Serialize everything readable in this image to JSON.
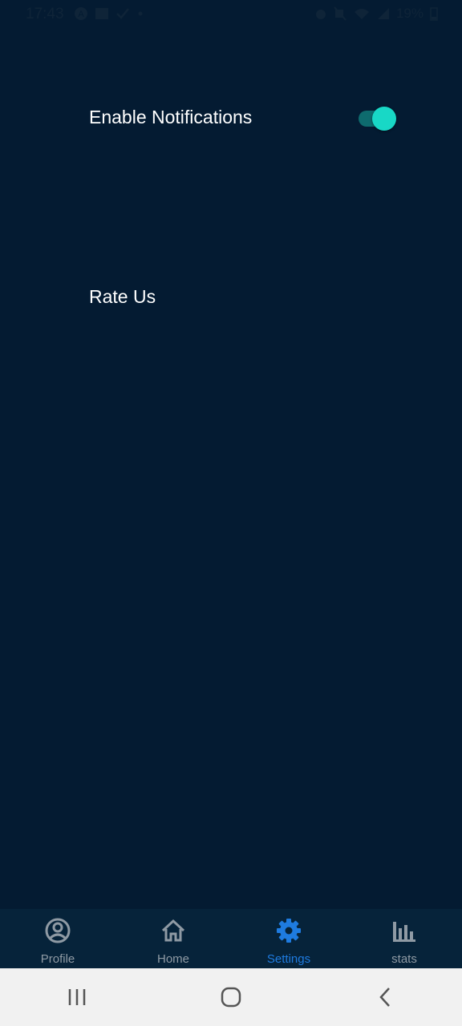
{
  "status_bar": {
    "time": "17:43",
    "left_icons": [
      "a-circle-icon",
      "image-icon",
      "check-icon",
      "dot-icon"
    ],
    "right_icons": [
      "alarm-icon",
      "mute-icon",
      "wifi-icon",
      "signal-icon"
    ],
    "battery": "19%"
  },
  "settings": {
    "notifications_label": "Enable Notifications",
    "notifications_enabled": true,
    "rate_label": "Rate Us"
  },
  "bottom_nav": {
    "items": [
      {
        "label": "Profile",
        "icon": "profile-icon"
      },
      {
        "label": "Home",
        "icon": "home-icon"
      },
      {
        "label": "Settings",
        "icon": "gear-icon"
      },
      {
        "label": "stats",
        "icon": "bar-chart-icon"
      }
    ],
    "active": "Settings"
  },
  "colors": {
    "background": "#041b32",
    "accent": "#1e7be0",
    "toggle": "#18d8c6",
    "nav_inactive": "#8f9aa4"
  }
}
